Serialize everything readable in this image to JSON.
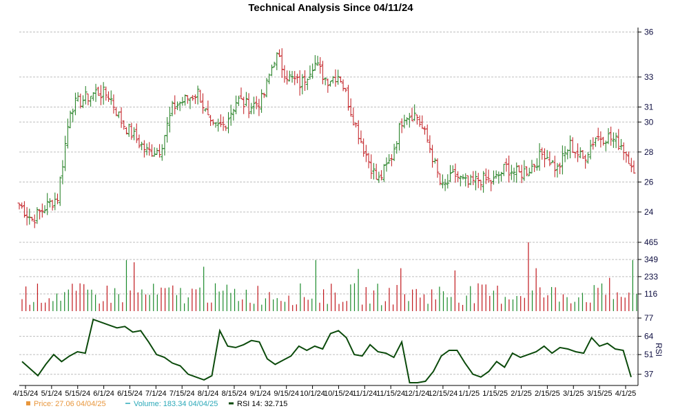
{
  "chart_data": {
    "type": "ohlc",
    "title": "Technical Analysis Since 04/11/24",
    "x_tick_labels": [
      "4/15/24",
      "5/1/24",
      "5/15/24",
      "6/1/24",
      "6/15/24",
      "7/1/24",
      "7/15/24",
      "8/1/24",
      "8/15/24",
      "9/1/24",
      "9/15/24",
      "10/1/24",
      "10/15/24",
      "11/1/24",
      "11/15/24",
      "12/1/24",
      "12/15/24",
      "1/1/25",
      "1/15/25",
      "2/1/25",
      "2/15/25",
      "3/1/25",
      "3/15/25",
      "4/1/25"
    ],
    "price_panel": {
      "y_ticks": [
        24,
        26,
        28,
        30,
        31,
        33,
        36
      ],
      "ylim": [
        22.3,
        36.3
      ],
      "up_color": "#1a7a1a",
      "down_color": "#c0161b",
      "close_series_weekly_approx": [
        24.5,
        23.5,
        24.3,
        25.0,
        31.0,
        31.5,
        32.0,
        31.8,
        30.0,
        29.0,
        28.0,
        28.2,
        31.0,
        31.5,
        32.0,
        29.5,
        29.8,
        31.5,
        31.0,
        31.5,
        34.5,
        33.0,
        32.5,
        34.0,
        32.8,
        33.2,
        30.5,
        28.0,
        26.0,
        27.5,
        30.5,
        30.5,
        28.5,
        25.5,
        26.5,
        25.8,
        26.2,
        26.0,
        27.0,
        26.5,
        27.0,
        28.0,
        26.8,
        28.5,
        27.5,
        29.0,
        29.0,
        28.5,
        27.06
      ]
    },
    "volume_panel": {
      "y_ticks": [
        116,
        233,
        349,
        465
      ],
      "ylim": [
        0,
        465
      ]
    },
    "rsi_panel": {
      "label": "RSI",
      "y_ticks": [
        37,
        51,
        64,
        77
      ],
      "ylim": [
        30,
        78
      ],
      "line_color": "#0b4a0b",
      "values": [
        46,
        41,
        36,
        44,
        51,
        46,
        50,
        53,
        52,
        76,
        74,
        72,
        70,
        71,
        67,
        68,
        60,
        51,
        49,
        45,
        43,
        37,
        35,
        33,
        36,
        68,
        57,
        56,
        58,
        61,
        60,
        48,
        44,
        47,
        50,
        57,
        54,
        57,
        55,
        66,
        68,
        63,
        51,
        50,
        58,
        53,
        52,
        49,
        60,
        31,
        31,
        32,
        39,
        50,
        54,
        54,
        45,
        37,
        35,
        39,
        46,
        42,
        52,
        49,
        51,
        53,
        57,
        52,
        56,
        55,
        53,
        52,
        63,
        57,
        59,
        55,
        54,
        35
      ]
    },
    "legend": [
      {
        "label": "Price: 27.06  04/04/25",
        "color": "#e8963c"
      },
      {
        "label": "Volume: 183.34  04/04/25",
        "color": "#2aa8b8"
      },
      {
        "label": "RSI 14: 32.715",
        "color": "#0b4a0b"
      }
    ]
  }
}
